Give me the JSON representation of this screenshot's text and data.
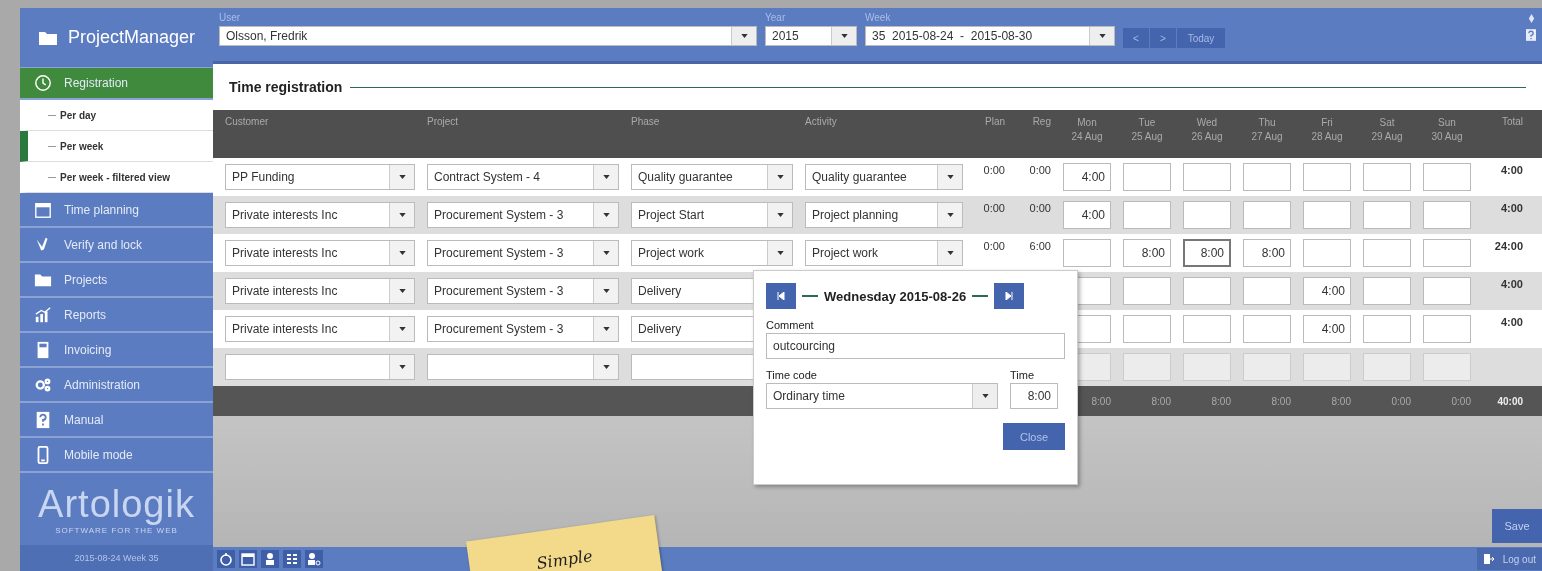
{
  "sidebar": {
    "app_title": "ProjectManager",
    "items": [
      {
        "kind": "section",
        "label": "Registration",
        "selected": true
      },
      {
        "kind": "subitem",
        "label": "Per day",
        "selected": false
      },
      {
        "kind": "subitem",
        "label": "Per week",
        "selected": true
      },
      {
        "kind": "subitem",
        "label": "Per week - filtered view",
        "selected": false
      },
      {
        "kind": "section",
        "label": "Time planning",
        "selected": false
      },
      {
        "kind": "section",
        "label": "Verify and lock",
        "selected": false
      },
      {
        "kind": "section",
        "label": "Projects",
        "selected": false
      },
      {
        "kind": "section",
        "label": "Reports",
        "selected": false
      },
      {
        "kind": "section",
        "label": "Invoicing",
        "selected": false
      },
      {
        "kind": "section",
        "label": "Administration",
        "selected": false
      },
      {
        "kind": "section",
        "label": "Manual",
        "selected": false
      },
      {
        "kind": "section",
        "label": "Mobile mode",
        "selected": false
      }
    ],
    "logo": "Artologik",
    "logo_tagline": "SOFTWARE FOR THE WEB",
    "footer": "2015-08-24 Week 35"
  },
  "top_bar": {
    "user_label": "User",
    "user": "Olsson, Fredrik",
    "year_label": "Year",
    "year": "2015",
    "week_label": "Week",
    "week": "35  2015-08-24  -  2015-08-30",
    "prev": "<",
    "next": ">",
    "today": "Today"
  },
  "section_title": "Time registration",
  "table": {
    "columns": [
      "Customer",
      "Project",
      "Phase",
      "Activity",
      "Plan",
      "Reg"
    ],
    "days": [
      {
        "day": "Mon",
        "date": "24 Aug"
      },
      {
        "day": "Tue",
        "date": "25 Aug"
      },
      {
        "day": "Wed",
        "date": "26 Aug"
      },
      {
        "day": "Thu",
        "date": "27 Aug"
      },
      {
        "day": "Fri",
        "date": "28 Aug"
      },
      {
        "day": "Sat",
        "date": "29 Aug"
      },
      {
        "day": "Sun",
        "date": "30 Aug"
      }
    ],
    "total_label": "Total",
    "rows": [
      {
        "kind": "entry",
        "customer": "PP Funding",
        "project": "Contract System - 4",
        "phase": "Quality guarantee",
        "activity": "Quality guarantee",
        "plan": "0:00",
        "reg": "0:00",
        "cells": [
          {
            "value": "4:00",
            "selected": false
          },
          {
            "selected": false
          },
          {
            "selected": false
          },
          {
            "selected": false
          },
          {
            "selected": false
          },
          {
            "selected": false
          },
          {
            "selected": false
          }
        ],
        "total": "4:00"
      },
      {
        "kind": "entry",
        "customer": "Private interests Inc",
        "project": "Procurement System - 3",
        "phase": "Project Start",
        "activity": "Project planning",
        "plan": "0:00",
        "reg": "0:00",
        "cells": [
          {
            "value": "4:00",
            "selected": false
          },
          {
            "selected": false
          },
          {
            "selected": false
          },
          {
            "selected": false
          },
          {
            "selected": false
          },
          {
            "selected": false
          },
          {
            "selected": false
          }
        ],
        "total": "4:00"
      },
      {
        "kind": "entry",
        "customer": "Private interests Inc",
        "project": "Procurement System - 3",
        "phase": "Project work",
        "activity": "Project work",
        "plan": "0:00",
        "reg": "6:00",
        "cells": [
          {
            "selected": false
          },
          {
            "value": "8:00",
            "selected": false
          },
          {
            "value": "8:00",
            "selected": true
          },
          {
            "value": "8:00",
            "selected": false
          },
          {
            "selected": false
          },
          {
            "selected": false
          },
          {
            "selected": false
          }
        ],
        "total": "24:00"
      },
      {
        "kind": "entry",
        "customer": "Private interests Inc",
        "project": "Procurement System - 3",
        "phase": "Delivery",
        "cells": [
          {
            "selected": false
          },
          {
            "selected": false
          },
          {
            "selected": false
          },
          {
            "selected": false
          },
          {
            "value": "4:00",
            "selected": false
          },
          {
            "selected": false
          },
          {
            "selected": false
          }
        ],
        "total": "4:00"
      },
      {
        "kind": "entry",
        "customer": "Private interests Inc",
        "project": "Procurement System - 3",
        "phase": "Delivery",
        "cells": [
          {
            "selected": false
          },
          {
            "selected": false
          },
          {
            "selected": false
          },
          {
            "selected": false
          },
          {
            "value": "4:00",
            "selected": false
          },
          {
            "selected": false
          },
          {
            "selected": false
          }
        ],
        "total": "4:00"
      },
      {
        "kind": "new",
        "cells": [
          {
            "selected": false
          },
          {
            "selected": false
          },
          {
            "selected": false
          },
          {
            "selected": false
          },
          {
            "selected": false
          },
          {
            "selected": false
          },
          {
            "selected": false
          }
        ]
      }
    ],
    "day_totals": [
      "8:00",
      "8:00",
      "8:00",
      "8:00",
      "8:00",
      "0:00",
      "0:00"
    ],
    "grand_total": "40:00"
  },
  "popup": {
    "title": "Wednesday 2015-08-26",
    "comment_label": "Comment",
    "comment": "outcourcing",
    "time_code_label": "Time code",
    "time_code": "Ordinary time",
    "time_label": "Time",
    "time": "8:00",
    "close": "Close"
  },
  "save": "Save",
  "logout": "Log out",
  "sticky_note": "Simple"
}
